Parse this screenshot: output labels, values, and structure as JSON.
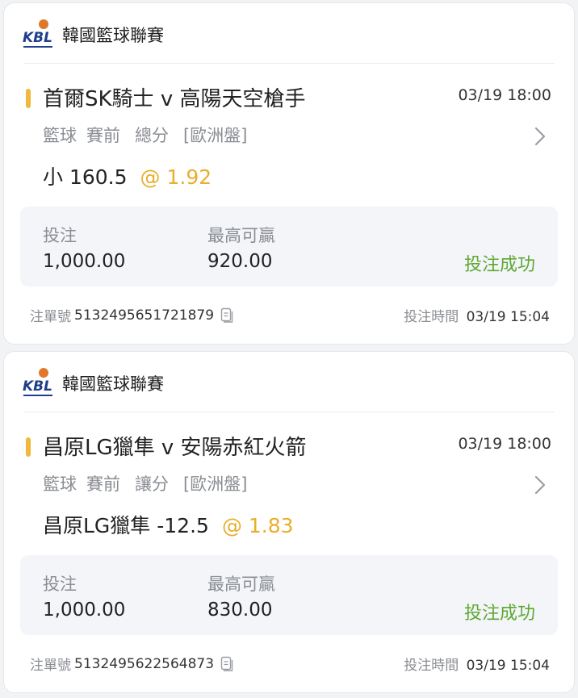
{
  "bets": [
    {
      "league": "韓國籃球聯賽",
      "match": "首爾SK騎士 v 高陽天空槍手",
      "match_time": "03/19 18:00",
      "sport": "籃球",
      "phase": "賽前",
      "market": "總分",
      "odds_type": "[歐洲盤]",
      "selection": "小 160.5",
      "odds": "@ 1.92",
      "stake_label": "投注",
      "stake": "1,000.00",
      "max_win_label": "最高可贏",
      "max_win": "920.00",
      "status": "投注成功",
      "order_label": "注單號",
      "order_no": "5132495651721879",
      "bet_time_label": "投注時間",
      "bet_time": "03/19 15:04"
    },
    {
      "league": "韓國籃球聯賽",
      "match": "昌原LG獵隼 v 安陽赤紅火箭",
      "match_time": "03/19 18:00",
      "sport": "籃球",
      "phase": "賽前",
      "market": "讓分",
      "odds_type": "[歐洲盤]",
      "selection": "昌原LG獵隼 -12.5",
      "odds": "@ 1.83",
      "stake_label": "投注",
      "stake": "1,000.00",
      "max_win_label": "最高可贏",
      "max_win": "830.00",
      "status": "投注成功",
      "order_label": "注單號",
      "order_no": "5132495622564873",
      "bet_time_label": "投注時間",
      "bet_time": "03/19 15:04"
    }
  ],
  "logo_text": "KBL",
  "colors": {
    "accent": "#f0b93c",
    "odds": "#e9ae2c",
    "success": "#5fa832",
    "muted": "#8a8d93",
    "logo_blue": "#1f3f8c",
    "logo_orange": "#e0782a"
  },
  "icons": {
    "expand": "chevron-right-icon",
    "copy": "copy-icon"
  }
}
